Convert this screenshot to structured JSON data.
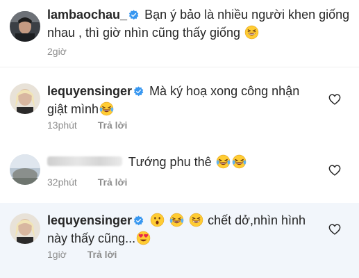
{
  "comments": [
    {
      "username": "lambaochau_",
      "verified": true,
      "text_line1": "Bạn ý bảo là nhiều người khen giống",
      "text_line2": "nhau , thì giờ nhìn cũng thấy giống",
      "time": "2giờ",
      "reply": ""
    },
    {
      "username": "lequyensinger",
      "verified": true,
      "text_line1": "Mà ký hoạ xong công nhận",
      "text_line2": "giật mình",
      "time": "13phút",
      "reply": "Trả lời"
    },
    {
      "username": "",
      "verified": false,
      "text_line1": "Tướng phu thê",
      "text_line2": "",
      "time": "32phút",
      "reply": "Trả lời"
    },
    {
      "username": "lequyensinger",
      "verified": true,
      "text_line1": "chết dở,nhìn hình",
      "text_line2": "này thấy cũng...",
      "time": "1giờ",
      "reply": "Trả lời"
    }
  ],
  "icons": {
    "verified_color": "#3897f0",
    "heart": "heart-outline-icon",
    "emoji_laugh": "laughing-tears-emoji",
    "emoji_grin": "grinning-squint-emoji",
    "emoji_hush": "hushed-face-emoji",
    "emoji_heart_eyes": "heart-eyes-emoji"
  }
}
